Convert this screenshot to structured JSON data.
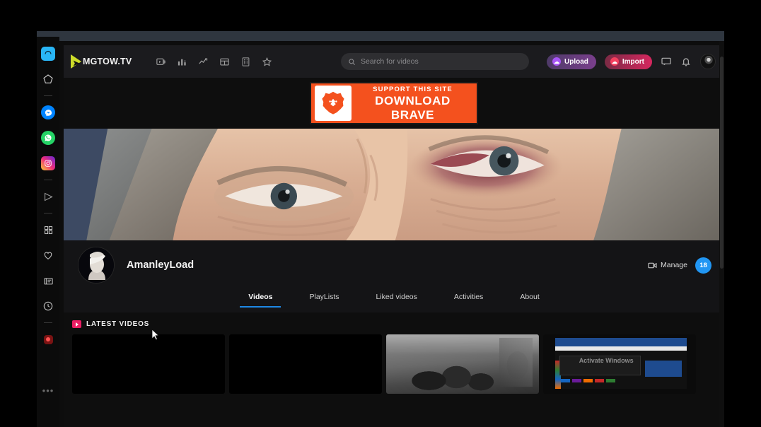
{
  "site": {
    "brand": "MGTOW.TV",
    "logo_icon": "play-triangle-logo"
  },
  "header": {
    "nav_icons": [
      {
        "name": "video-library-icon",
        "label": "Videos"
      },
      {
        "name": "bar-chart-icon",
        "label": "Statistics"
      },
      {
        "name": "trending-up-icon",
        "label": "Trending"
      },
      {
        "name": "dashboard-icon",
        "label": "Dashboard"
      },
      {
        "name": "list-icon",
        "label": "Channels"
      },
      {
        "name": "star-icon",
        "label": "Favorites"
      }
    ],
    "search": {
      "placeholder": "Search for videos",
      "value": "",
      "icon": "search-icon"
    },
    "upload_label": "Upload",
    "import_label": "Import",
    "message_icon": "chat-bubble-icon",
    "bell_icon": "notification-bell-icon",
    "avatar_icon": "user-avatar"
  },
  "banner": {
    "line1": "SUPPORT THIS SITE",
    "line2": "DOWNLOAD",
    "line3": "BRAVE",
    "logo_icon": "brave-lion-icon",
    "bg_color": "#f4511e"
  },
  "channel": {
    "name": "AmanleyLoad",
    "avatar_icon": "channel-avatar",
    "manage_label": "Manage",
    "manage_icon": "video-camera-icon",
    "video_count": "18",
    "badge_color": "#2196f3",
    "cover_alt": "close-up of an elderly person's face with a bruised eye"
  },
  "tabs": [
    {
      "label": "Videos",
      "active": true
    },
    {
      "label": "PlayLists",
      "active": false
    },
    {
      "label": "Liked videos",
      "active": false
    },
    {
      "label": "Activities",
      "active": false
    },
    {
      "label": "About",
      "active": false
    }
  ],
  "latest": {
    "title": "LATEST VIDEOS",
    "icon": "video-badge-icon",
    "accent_color": "#e91e63",
    "thumbnails": [
      {
        "name": "video-thumbnail-1",
        "kind": "black"
      },
      {
        "name": "video-thumbnail-2",
        "kind": "black"
      },
      {
        "name": "video-thumbnail-3",
        "kind": "bw-war-photo"
      },
      {
        "name": "video-thumbnail-4",
        "kind": "browser-screenshot",
        "watermark": "Activate Windows"
      }
    ]
  },
  "rail": {
    "items": [
      {
        "name": "rail-item-active-app",
        "icon": "rounded-square-icon",
        "color": "#29b6f6"
      },
      {
        "name": "rail-item-home",
        "icon": "pentagon-icon",
        "color": "#cfcfcf"
      },
      {
        "name": "rail-separator-1",
        "icon": "divider"
      },
      {
        "name": "rail-item-messenger",
        "icon": "messenger-icon",
        "color": "#0084ff"
      },
      {
        "name": "rail-item-whatsapp",
        "icon": "whatsapp-icon",
        "color": "#25d366"
      },
      {
        "name": "rail-item-instagram",
        "icon": "instagram-icon",
        "color": "#e1306c"
      },
      {
        "name": "rail-separator-2",
        "icon": "divider"
      },
      {
        "name": "rail-item-telegram",
        "icon": "send-icon",
        "color": "#9a9a9a"
      },
      {
        "name": "rail-separator-3",
        "icon": "divider"
      },
      {
        "name": "rail-item-apps",
        "icon": "grid-icon",
        "color": "#bdbdbd"
      },
      {
        "name": "rail-item-favorites",
        "icon": "heart-icon",
        "color": "#bdbdbd"
      },
      {
        "name": "rail-item-reader",
        "icon": "article-icon",
        "color": "#bdbdbd"
      },
      {
        "name": "rail-item-history",
        "icon": "clock-icon",
        "color": "#bdbdbd"
      },
      {
        "name": "rail-separator-4",
        "icon": "divider"
      },
      {
        "name": "rail-item-record",
        "icon": "record-icon",
        "color": "#d32f2f"
      }
    ],
    "more_label": "•••"
  }
}
